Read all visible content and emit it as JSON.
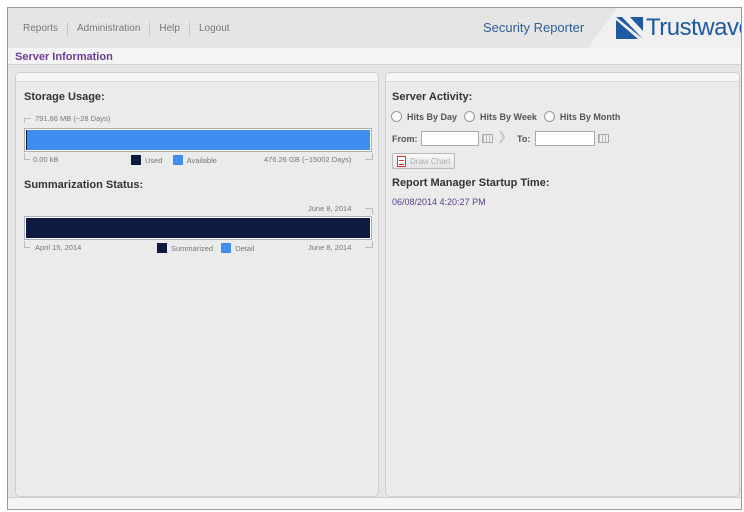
{
  "nav": {
    "items": [
      "Reports",
      "Administration",
      "Help",
      "Logout"
    ]
  },
  "header": {
    "product": "Security Reporter",
    "brand": "Trustwave",
    "brand_mark": "®"
  },
  "section": {
    "title": "Server Information"
  },
  "storage": {
    "title": "Storage Usage:",
    "top_caption": "791.86 MB (~28 Days)",
    "min_label": "0.00 kB",
    "max_label": "476.26 GB (~15002 Days)",
    "legend_used": "Used",
    "legend_available": "Available",
    "used_fraction": 0.0016,
    "colors": {
      "used": "#0d1b40",
      "available": "#3d8ef0"
    }
  },
  "summarization": {
    "title": "Summarization Status:",
    "top_caption": "June 8, 2014",
    "start_label": "April 15, 2014",
    "end_label": "June 8, 2014",
    "legend_summarized": "Summarized",
    "legend_detail": "Detail",
    "summarized_fraction": 1.0,
    "colors": {
      "summarized": "#0d1b40",
      "detail": "#3d8ef0"
    }
  },
  "activity": {
    "title": "Server Activity:",
    "radio_day": "Hits By Day",
    "radio_week": "Hits By Week",
    "radio_month": "Hits By Month",
    "from_label": "From:",
    "to_label": "To:",
    "from_value": "",
    "to_value": "",
    "draw_button": "Draw Chart"
  },
  "startup": {
    "title": "Report Manager Startup Time:",
    "value": "06/08/2014 4:20:27 PM"
  },
  "icons": {
    "calendar": "calendar-icon",
    "pdf": "pdf-icon",
    "arrow": "arrow-right-icon",
    "logo": "trustwave-logo-icon"
  }
}
